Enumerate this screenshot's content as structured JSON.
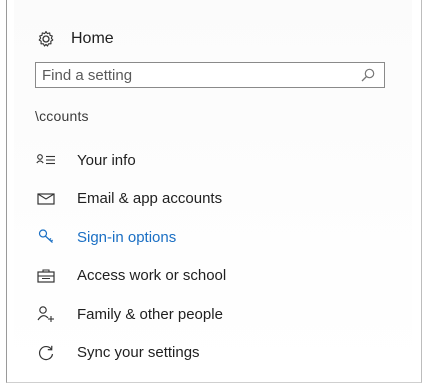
{
  "home": {
    "label": "Home",
    "icon": "gear-icon"
  },
  "search": {
    "placeholder": "Find a setting",
    "value": "",
    "icon": "search-icon"
  },
  "section": {
    "title": "\\ccounts"
  },
  "nav": {
    "items": [
      {
        "label": "Your info",
        "icon": "person-list-icon",
        "active": false
      },
      {
        "label": "Email & app accounts",
        "icon": "mail-icon",
        "active": false
      },
      {
        "label": "Sign-in options",
        "icon": "key-icon",
        "active": true
      },
      {
        "label": "Access work or school",
        "icon": "briefcase-icon",
        "active": false
      },
      {
        "label": "Family & other people",
        "icon": "add-person-icon",
        "active": false
      },
      {
        "label": "Sync your settings",
        "icon": "sync-icon",
        "active": false
      }
    ]
  },
  "colors": {
    "accent": "#1a6fc4",
    "text": "#1f1f1f",
    "border": "#8a8a8a"
  }
}
